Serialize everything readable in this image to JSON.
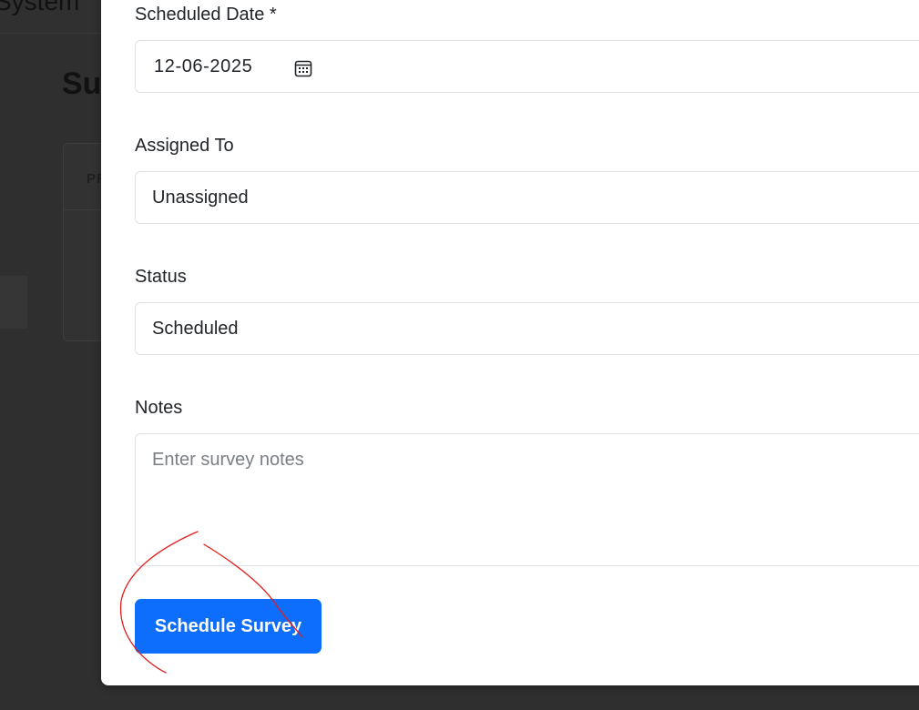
{
  "background": {
    "app_title": "System",
    "page_title": "Su",
    "table_header": "PF"
  },
  "form": {
    "scheduled_date": {
      "label": "Scheduled Date *",
      "value": "12-06-2025",
      "icon": "calendar-icon"
    },
    "assigned_to": {
      "label": "Assigned To",
      "value": "Unassigned"
    },
    "status": {
      "label": "Status",
      "value": "Scheduled"
    },
    "notes": {
      "label": "Notes",
      "placeholder": "Enter survey notes"
    },
    "submit_label": "Schedule Survey"
  },
  "colors": {
    "primary": "#0d6efd",
    "annotation": "#e31b1b",
    "overlay": "#2f2f2f"
  }
}
